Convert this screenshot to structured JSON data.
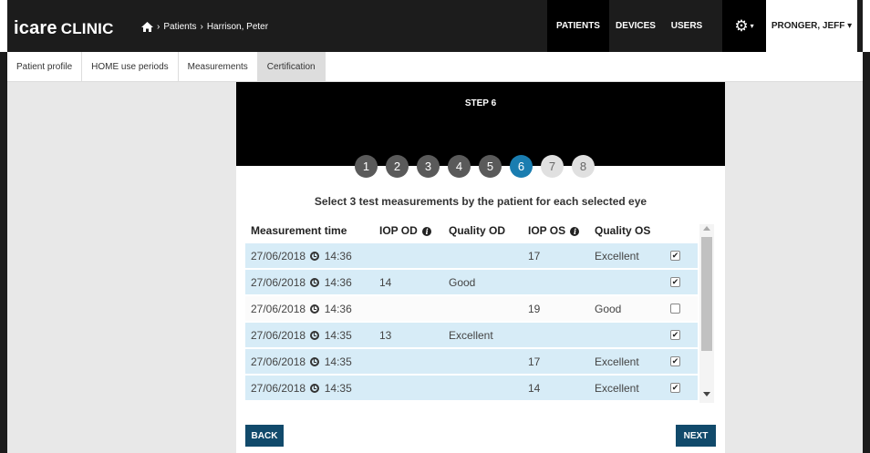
{
  "app": {
    "brand": "icare",
    "brand_suffix": "CLINIC"
  },
  "breadcrumb": {
    "home_icon": "home-icon",
    "separator": "›",
    "items": [
      "Patients",
      "Harrison, Peter"
    ]
  },
  "nav": {
    "patients": "PATIENTS",
    "devices": "DEVICES",
    "users": "USERS",
    "user_menu": "PRONGER, JEFF ▾",
    "gear_caret": "▾"
  },
  "tabs": [
    {
      "label": "Patient profile"
    },
    {
      "label": "HOME use periods"
    },
    {
      "label": "Measurements"
    },
    {
      "label": "Certification"
    }
  ],
  "wizard": {
    "title": "STEP 6",
    "steps": [
      "1",
      "2",
      "3",
      "4",
      "5",
      "6",
      "7",
      "8"
    ],
    "current_step": 6,
    "instruction": "Select 3 test measurements by the patient for each selected eye"
  },
  "table": {
    "headers": {
      "time": "Measurement time",
      "iop_od": "IOP OD",
      "quality_od": "Quality OD",
      "iop_os": "IOP OS",
      "quality_os": "Quality OS"
    },
    "rows": [
      {
        "date": "27/06/2018",
        "time": "14:36",
        "iop_od": "",
        "quality_od": "",
        "iop_os": "17",
        "quality_os": "Excellent",
        "checked": true
      },
      {
        "date": "27/06/2018",
        "time": "14:36",
        "iop_od": "14",
        "quality_od": "Good",
        "iop_os": "",
        "quality_os": "",
        "checked": true
      },
      {
        "date": "27/06/2018",
        "time": "14:36",
        "iop_od": "",
        "quality_od": "",
        "iop_os": "19",
        "quality_os": "Good",
        "checked": false
      },
      {
        "date": "27/06/2018",
        "time": "14:35",
        "iop_od": "13",
        "quality_od": "Excellent",
        "iop_os": "",
        "quality_os": "",
        "checked": true
      },
      {
        "date": "27/06/2018",
        "time": "14:35",
        "iop_od": "",
        "quality_od": "",
        "iop_os": "17",
        "quality_os": "Excellent",
        "checked": true
      },
      {
        "date": "27/06/2018",
        "time": "14:35",
        "iop_od": "",
        "quality_od": "",
        "iop_os": "14",
        "quality_os": "Excellent",
        "checked": true
      }
    ]
  },
  "buttons": {
    "back": "BACK",
    "next": "NEXT"
  },
  "colors": {
    "topbar": "#1c1c1c",
    "accent": "#1a7db0",
    "button": "#114a6b",
    "row_selected": "#d7ecf7"
  }
}
